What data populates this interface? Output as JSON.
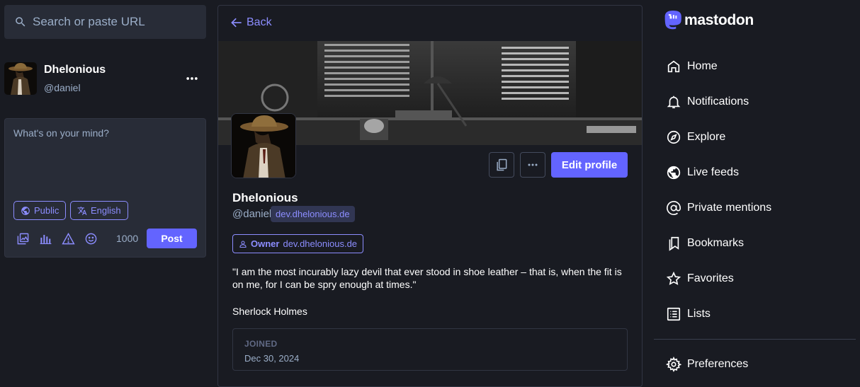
{
  "search": {
    "placeholder": "Search or paste URL",
    "icon": "search-icon"
  },
  "account": {
    "display_name": "Dhelonious",
    "handle": "@daniel"
  },
  "composer": {
    "placeholder": "What's on your mind?",
    "visibility_label": "Public",
    "language_label": "English",
    "char_count": "1000",
    "post_label": "Post"
  },
  "profile": {
    "back_label": "Back",
    "display_name": "Dhelonious",
    "handle": "@daniel",
    "domain": "dev.dhelonious.de",
    "edit_label": "Edit profile",
    "role": {
      "name": "Owner",
      "domain": "dev.dhelonious.de"
    },
    "bio": [
      "\"I am the most incurably lazy devil that ever stood in shoe leather – that is, when the fit is on me, for I can be spry enough at times.\"",
      "Sherlock Holmes"
    ],
    "joined_label": "JOINED",
    "joined_date": "Dec 30, 2024"
  },
  "brand": {
    "wordmark": "mastodon"
  },
  "nav": {
    "items": [
      {
        "label": "Home",
        "icon": "home-icon"
      },
      {
        "label": "Notifications",
        "icon": "bell-icon"
      },
      {
        "label": "Explore",
        "icon": "compass-icon"
      },
      {
        "label": "Live feeds",
        "icon": "globe-icon"
      },
      {
        "label": "Private mentions",
        "icon": "at-icon"
      },
      {
        "label": "Bookmarks",
        "icon": "bookmarks-icon"
      },
      {
        "label": "Favorites",
        "icon": "star-icon"
      },
      {
        "label": "Lists",
        "icon": "list-icon"
      },
      {
        "label": "Preferences",
        "icon": "gear-icon"
      }
    ]
  },
  "colors": {
    "accent": "#6364ff",
    "accent_text": "#8c8dff",
    "background": "#191b22",
    "panel": "#282c37",
    "muted_text": "#9baec8"
  }
}
